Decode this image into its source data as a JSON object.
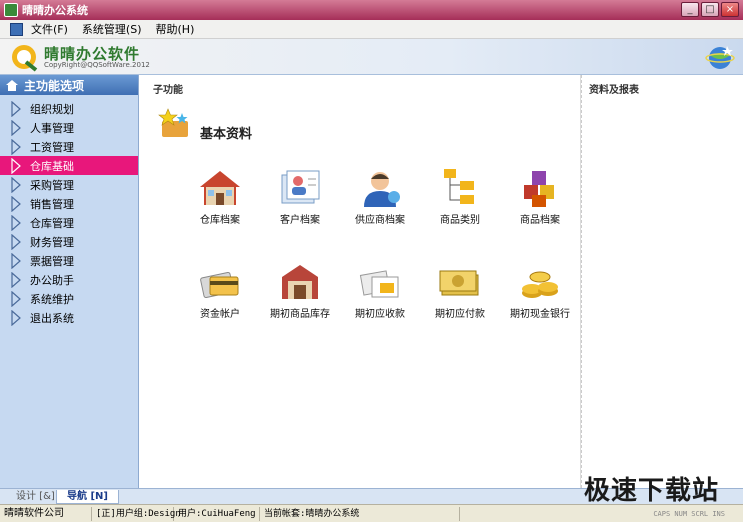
{
  "window": {
    "title": "晴晴办公系统"
  },
  "menu": [
    "文件(F)",
    "系统管理(S)",
    "帮助(H)"
  ],
  "banner": {
    "brand": "晴晴办公软件",
    "copyright": "CopyRight@QQSoftWare.2012"
  },
  "sidebar": {
    "header": "主功能选项",
    "items": [
      "组织规划",
      "人事管理",
      "工资管理",
      "仓库基础",
      "采购管理",
      "销售管理",
      "仓库管理",
      "财务管理",
      "票据管理",
      "办公助手",
      "系统维护",
      "退出系统"
    ],
    "active_index": 3
  },
  "main": {
    "section_label": "子功能",
    "section_title": "基本资料",
    "functions": [
      {
        "label": "仓库档案",
        "icon": "house-icon"
      },
      {
        "label": "客户档案",
        "icon": "customer-files-icon"
      },
      {
        "label": "供应商档案",
        "icon": "supplier-user-icon"
      },
      {
        "label": "商品类别",
        "icon": "folder-tree-icon"
      },
      {
        "label": "商品档案",
        "icon": "cubes-icon"
      },
      {
        "label": "资金帐户",
        "icon": "card-icon"
      },
      {
        "label": "期初商品库存",
        "icon": "warehouse-icon"
      },
      {
        "label": "期初应收款",
        "icon": "receivable-icon"
      },
      {
        "label": "期初应付款",
        "icon": "banknote-icon"
      },
      {
        "label": "期初现金银行",
        "icon": "coins-icon"
      }
    ]
  },
  "right_panel": {
    "label": "资料及报表"
  },
  "tabs": {
    "design": "设计 [&]",
    "navigation": "导航 [N]"
  },
  "status": {
    "company": "晴晴软件公司",
    "group": "[正]用户组:Design",
    "user": "用户:CuiHuaFeng",
    "account": "当前帐套:晴晴办公系统",
    "keys": "CAPS NUM SCRL INS"
  },
  "watermark": "极速下载站",
  "colors": {
    "titlebar": "#a52e58",
    "active_item": "#e8177b",
    "sidebar_bg": "#c6d9f1"
  }
}
